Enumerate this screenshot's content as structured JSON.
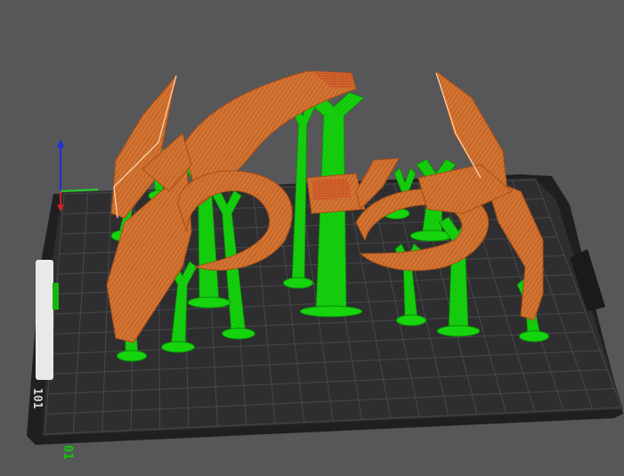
{
  "viewport": {
    "background_color": "#575759",
    "bed_color": "#2e2e30",
    "bed_grid_color": "#4b4b4f",
    "bed_frame_color": "#1f1f21",
    "model_color": "#c8692a",
    "model_highlight_color": "#f0a25a",
    "support_color": "#16d40e",
    "support_dark_color": "#0ea10a",
    "seam_color": "#d93a2a"
  },
  "axes": {
    "x_axis_color": "#d32020",
    "y_axis_color": "#1ed21e",
    "z_axis_color": "#2030d8"
  },
  "bed": {
    "brand_label": "101",
    "edge_label": "01",
    "ruler_ticks": "0"
  }
}
